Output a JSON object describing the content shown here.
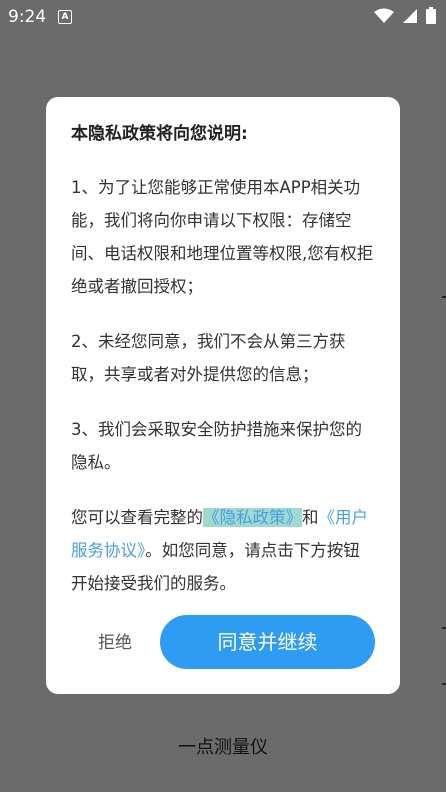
{
  "status": {
    "time": "9:24",
    "notification_icon": "a-badge-icon",
    "icons": [
      "wifi-icon",
      "signal-icon",
      "battery-icon"
    ]
  },
  "dialog": {
    "title": "本隐私政策将向您说明:",
    "p1": "1、为了让您能够正常使用本APP相关功能，我们将向你申请以下权限：存储空间、电话权限和地理位置等权限,您有权拒绝或者撤回授权；",
    "p2": "2、未经您同意，我们不会从第三方获取，共享或者对外提供您的信息；",
    "p3": "3、我们会采取安全防护措施来保护您的隐私。",
    "p4_prefix": "您可以查看完整的",
    "privacy_link": "《隐私政策》",
    "p4_and": "和",
    "service_link": "《用户服务协议》",
    "p4_suffix": "。如您同意，请点击下方按钮开始接受我们的服务。",
    "reject_label": "拒绝",
    "agree_label": "同意并继续"
  },
  "background": {
    "app_name": "一点测量仪"
  },
  "colors": {
    "overlay": "#6b6b6b",
    "accent": "#2d9cf2",
    "link": "#4a9fe6",
    "link_highlight": "#9fd9cf"
  }
}
